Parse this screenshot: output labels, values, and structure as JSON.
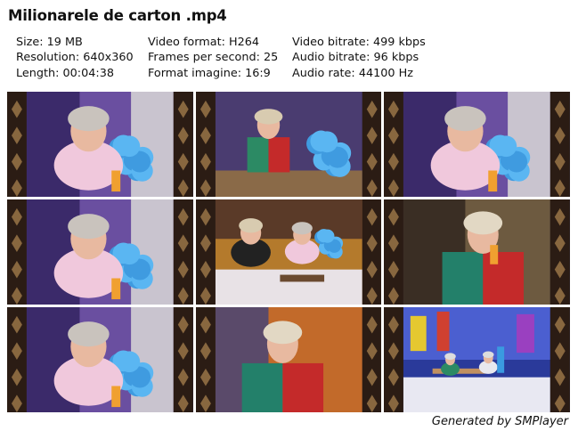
{
  "title": "Milionarele de carton .mp4",
  "info": {
    "col1": [
      "Size: 19 MB",
      "Resolution: 640x360",
      "Length: 00:04:38"
    ],
    "col2": [
      "Video format: H264",
      "Frames per second: 25",
      "Format imagine: 16:9"
    ],
    "col3": [
      "Video bitrate: 499 kbps",
      "Audio bitrate: 96 kbps",
      "Audio rate: 44100 Hz"
    ]
  },
  "thumbnails": [
    {
      "scene": "closeup-pink-blouse-blue-feathers"
    },
    {
      "scene": "seated-green-red-jacket-blue-feathers"
    },
    {
      "scene": "closeup-pink-blouse-blue-feathers"
    },
    {
      "scene": "closeup-pink-blouse-blue-feathers"
    },
    {
      "scene": "wide-two-women-sofa"
    },
    {
      "scene": "closeup-green-red-jacket-drinking"
    },
    {
      "scene": "closeup-pink-blouse-blue-feathers"
    },
    {
      "scene": "closeup-green-red-jacket"
    },
    {
      "scene": "wide-stage-set"
    }
  ],
  "footer": "Generated by SMPlayer"
}
